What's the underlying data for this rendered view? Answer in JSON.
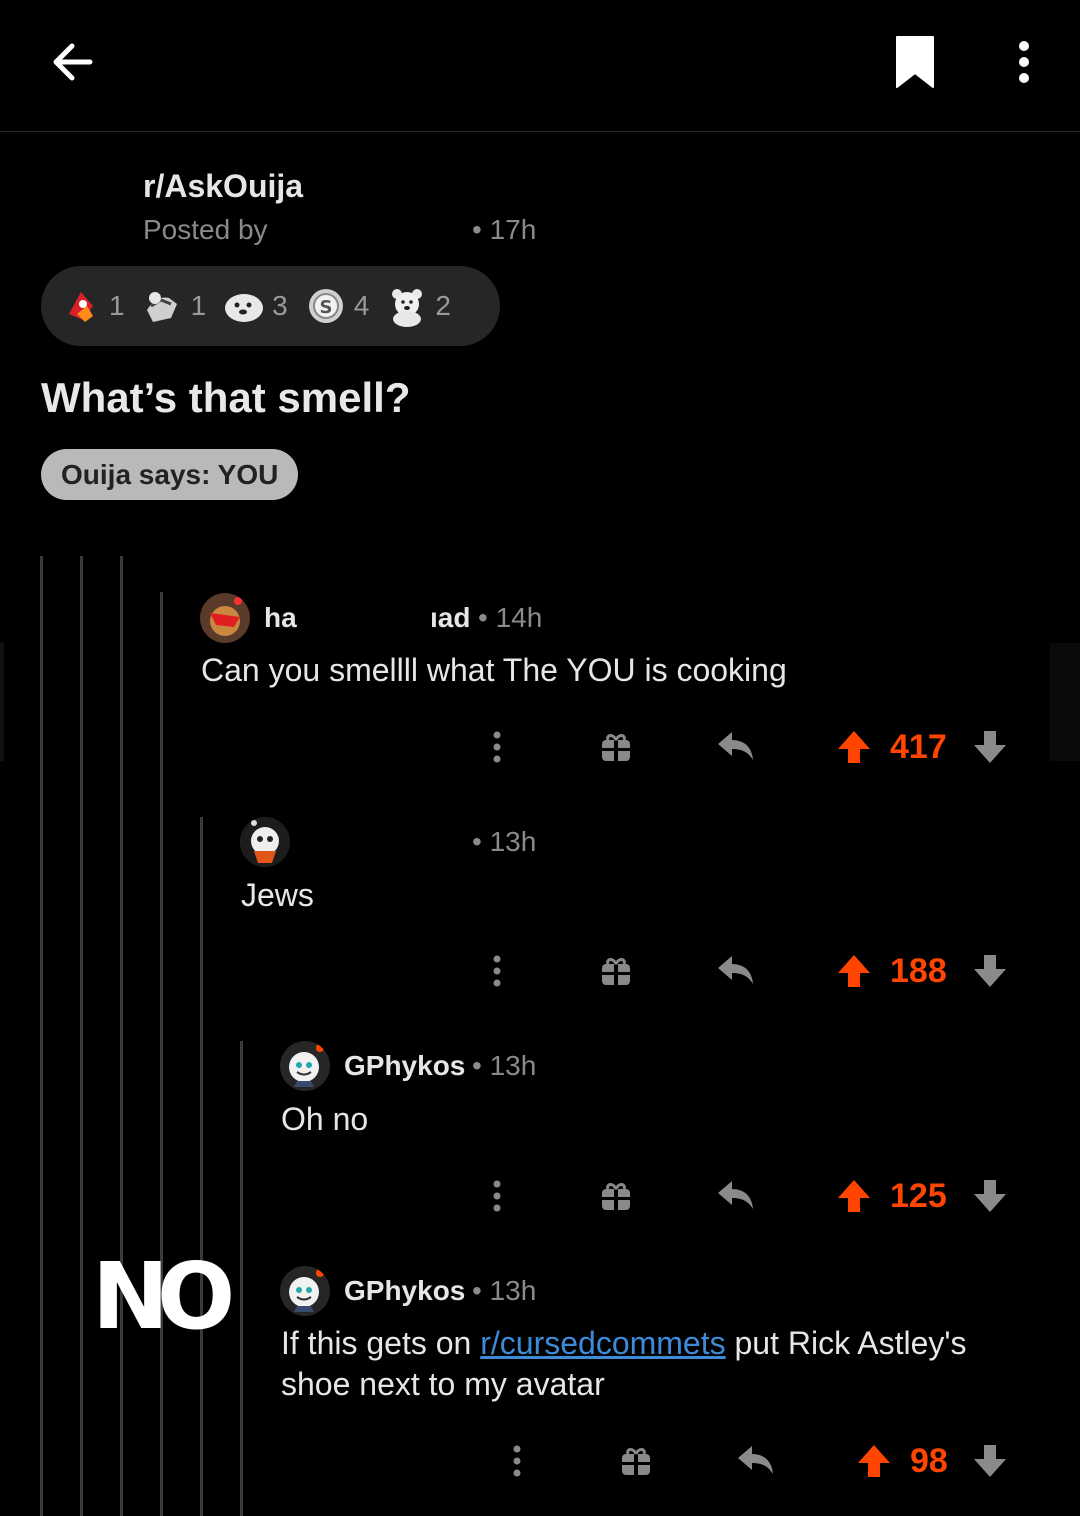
{
  "header": {
    "back_icon": "arrow-left-icon",
    "save_icon": "bookmark-icon",
    "more_icon": "more-vertical-icon"
  },
  "post": {
    "subreddit": "r/AskOuija",
    "posted_by": "Posted by",
    "time": "• 17h",
    "awards": [
      {
        "icon": "rocket-like-award-icon",
        "count": "1"
      },
      {
        "icon": "hugz-award-icon",
        "count": "1"
      },
      {
        "icon": "seal-award-icon",
        "count": "3"
      },
      {
        "icon": "silver-award-icon",
        "count": "4"
      },
      {
        "icon": "wholesome-bear-award-icon",
        "count": "2"
      }
    ],
    "title": "What’s that smell?",
    "flair": "Ouija says: YOU"
  },
  "comments": [
    {
      "author": "ha",
      "author_tail": "ıad",
      "time": "• 14h",
      "body": "Can you smellll what The YOU is cooking",
      "score": "417"
    },
    {
      "author": "",
      "time": "• 13h",
      "body": "Jews",
      "score": "188"
    },
    {
      "author": "GPhykos",
      "time": "• 13h",
      "body": "Oh no",
      "score": "125"
    },
    {
      "author": "GPhykos",
      "time": "• 13h",
      "body_before": "If this gets on",
      "body_link": "r/cursedcommets",
      "body_after": "put Rick Astley's shoe next to my avatar",
      "score": "98"
    }
  ],
  "sticker": {
    "text": "NO"
  },
  "colors": {
    "upvote": "#ff4500",
    "link": "#3d8bd8",
    "background": "#000000"
  }
}
